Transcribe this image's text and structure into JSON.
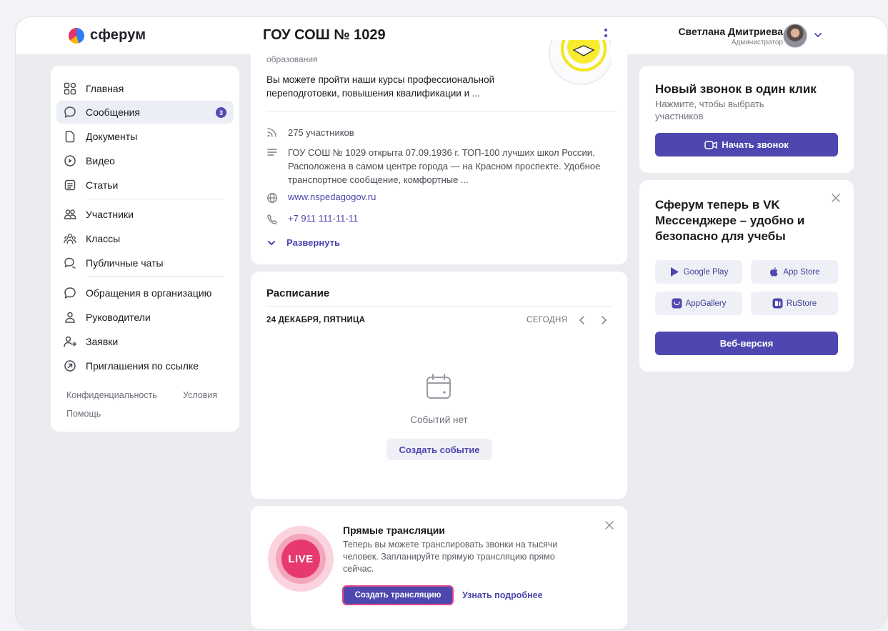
{
  "header": {
    "logo_text": "сферум",
    "org_title": "ГОУ СОШ № 1029",
    "user_name": "Светлана Дмитриева",
    "user_role": "Администратор"
  },
  "sidebar": {
    "items": [
      {
        "label": "Главная",
        "icon": "grid-icon"
      },
      {
        "label": "Сообщения",
        "icon": "chat-bubble-icon",
        "badge": "3",
        "active": true
      },
      {
        "label": "Документы",
        "icon": "document-icon"
      },
      {
        "label": "Видео",
        "icon": "play-circle-icon"
      },
      {
        "label": "Статьи",
        "icon": "article-icon"
      },
      {
        "label": "Участники",
        "icon": "people-icon"
      },
      {
        "label": "Классы",
        "icon": "group-icon"
      },
      {
        "label": "Публичные чаты",
        "icon": "public-chat-icon"
      },
      {
        "label": "Обращения в организацию",
        "icon": "chat-bubble-icon"
      },
      {
        "label": "Руководители",
        "icon": "person-icon"
      },
      {
        "label": "Заявки",
        "icon": "person-arrow-icon"
      },
      {
        "label": "Приглашения по ссылке",
        "icon": "arrow-circle-icon"
      }
    ],
    "footer": {
      "privacy": "Конфиденциальность",
      "terms": "Условия",
      "help": "Помощь"
    }
  },
  "about": {
    "truncated_top": "образования",
    "promo_text": "Вы можете пройти наши курсы профессиональной переподготовки, повышения квалификации и ...",
    "members": "275 участников",
    "description": "ГОУ СОШ № 1029 открыта 07.09.1936 г. ТОП-100 лучших школ России. Расположена в самом центре города — на Красном проспекте. Удобное транспортное сообщение, комфортные ...",
    "website": "www.nspedagogov.ru",
    "phone": "+7 911 111-11-11",
    "expand_label": "Развернуть"
  },
  "schedule": {
    "title": "Расписание",
    "date": "24 ДЕКАБРЯ, ПЯТНИЦА",
    "today_label": "СЕГОДНЯ",
    "empty_text": "Событий нет",
    "create_event": "Создать событие"
  },
  "live": {
    "badge": "LIVE",
    "title": "Прямые трансляции",
    "description": "Теперь вы можете транслировать звонки на тысячи человек. Запланируйте прямую трансляцию прямо сейчас.",
    "create_button": "Создать трансляцию",
    "more_link": "Узнать подробнее"
  },
  "call": {
    "title": "Новый звонок в один клик",
    "description": "Нажмите, чтобы выбрать участников",
    "button": "Начать звонок"
  },
  "vk": {
    "title": "Сферум теперь в VK Мессенджере – удобно и безопасно для учебы",
    "stores": [
      "Google Play",
      "App Store",
      "AppGallery",
      "RuStore"
    ],
    "web_button": "Веб-версия"
  },
  "colors": {
    "accent": "#4d47af",
    "live": "#e8396e",
    "background": "#ebecf0"
  }
}
